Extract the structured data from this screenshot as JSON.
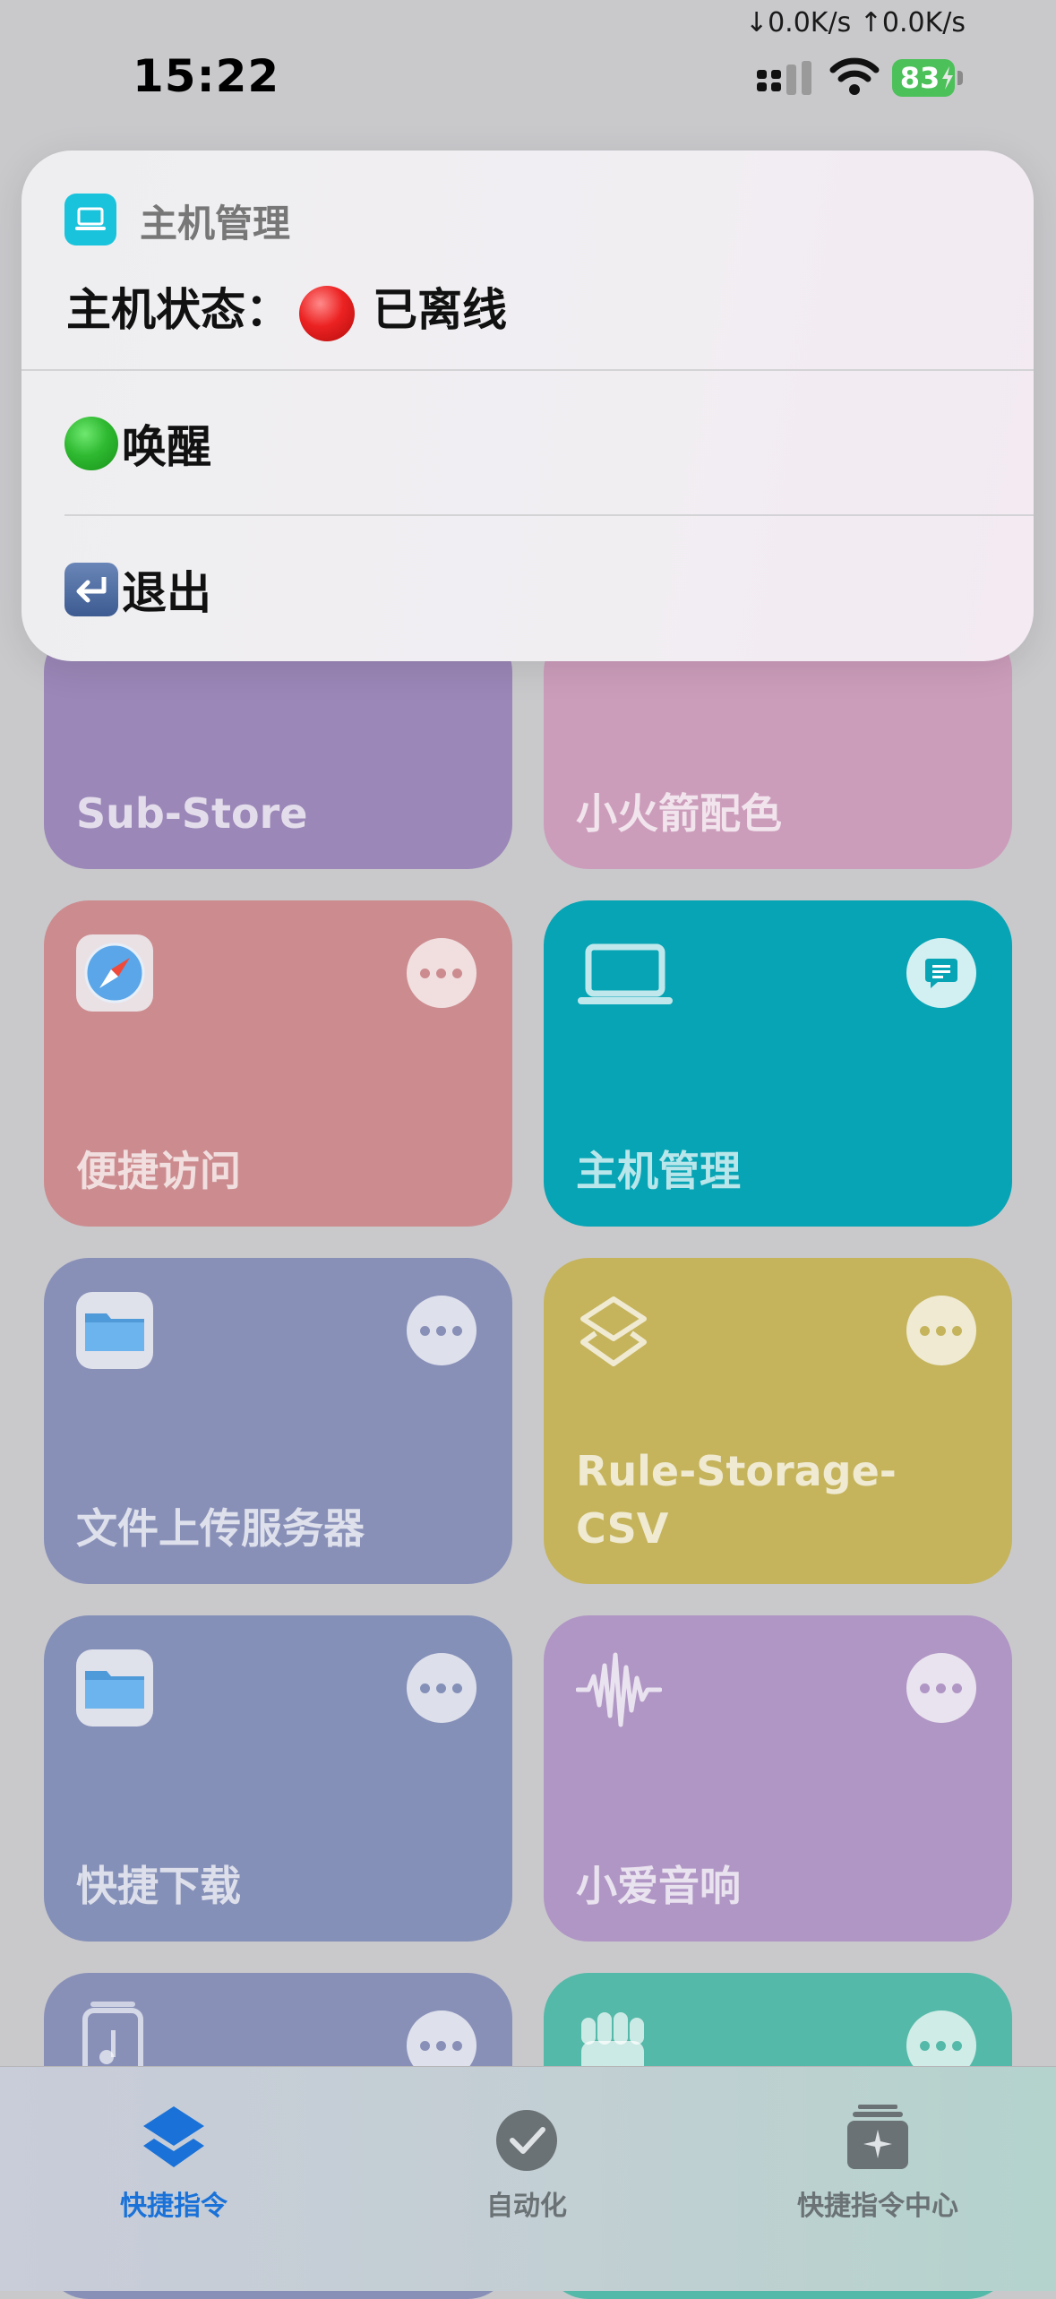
{
  "status_bar": {
    "net_speed": "↓0.0K/s ↑0.0K/s",
    "time": "15:22",
    "battery": "83"
  },
  "popup": {
    "app_name": "主机管理",
    "status_text": "主机状态：",
    "status_value": "已离线",
    "items": [
      {
        "label": "唤醒",
        "icon": "green-circle-icon"
      },
      {
        "label": "退出",
        "icon": "return-arrow-icon"
      }
    ]
  },
  "tiles": [
    {
      "title": "Sub-Store",
      "color": "#9b87b8"
    },
    {
      "title": "小火箭配色",
      "color": "#cc9dbb"
    },
    {
      "title": "便捷访问",
      "color": "#cc8c8f",
      "icon": "safari-icon"
    },
    {
      "title": "主机管理",
      "color": "#06a4b4",
      "icon": "laptop-icon"
    },
    {
      "title": "文件上传服务器",
      "color": "#8890b8",
      "icon": "folder-icon"
    },
    {
      "title": "Rule-Storage-\nCSV",
      "color": "#c5b45c",
      "icon": "shortcuts-icon"
    },
    {
      "title": "快捷下载",
      "color": "#8590b8",
      "icon": "folder-icon"
    },
    {
      "title": "小爱音响",
      "color": "#b096c4",
      "icon": "waveform-icon"
    },
    {
      "title": "",
      "color": "#8890b8",
      "icon": "music-file-icon"
    },
    {
      "title": "",
      "color": "#54b9a8",
      "icon": "fist-icon"
    }
  ],
  "tabbar": {
    "tabs": [
      {
        "label": "快捷指令",
        "active": true
      },
      {
        "label": "自动化",
        "active": false
      },
      {
        "label": "快捷指令中心",
        "active": false
      }
    ],
    "active_color": "#1a72d8",
    "inactive_color": "#6b7275"
  }
}
